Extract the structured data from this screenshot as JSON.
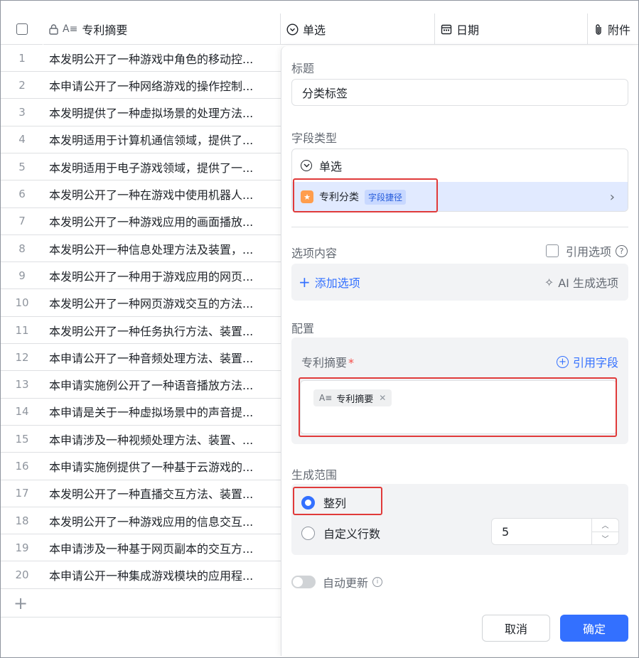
{
  "header": {
    "summary_col": "专利摘要",
    "single_col": "单选",
    "date_col": "日期",
    "attach_col": "附件"
  },
  "rows": [
    {
      "num": "1",
      "text": "本发明公开了一种游戏中角色的移动控..."
    },
    {
      "num": "2",
      "text": "本申请公开了一种网络游戏的操作控制..."
    },
    {
      "num": "3",
      "text": "本发明提供了一种虚拟场景的处理方法..."
    },
    {
      "num": "4",
      "text": "本发明适用于计算机通信领域，提供了..."
    },
    {
      "num": "5",
      "text": "本发明适用于电子游戏领域，提供了一..."
    },
    {
      "num": "6",
      "text": "本发明公开了一种在游戏中使用机器人..."
    },
    {
      "num": "7",
      "text": "本发明公开了一种游戏应用的画面播放..."
    },
    {
      "num": "8",
      "text": "本发明公开一种信息处理方法及装置，..."
    },
    {
      "num": "9",
      "text": "本发明公开了一种用于游戏应用的网页..."
    },
    {
      "num": "10",
      "text": "本发明公开了一种网页游戏交互的方法..."
    },
    {
      "num": "11",
      "text": "本发明公开了一种任务执行方法、装置..."
    },
    {
      "num": "12",
      "text": "本申请公开了一种音频处理方法、装置..."
    },
    {
      "num": "13",
      "text": "本申请实施例公开了一种语音播放方法..."
    },
    {
      "num": "14",
      "text": "本申请是关于一种虚拟场景中的声音提..."
    },
    {
      "num": "15",
      "text": "本申请涉及一种视频处理方法、装置、..."
    },
    {
      "num": "16",
      "text": "本申请实施例提供了一种基于云游戏的..."
    },
    {
      "num": "17",
      "text": "本发明公开了一种直播交互方法、装置..."
    },
    {
      "num": "18",
      "text": "本发明公开了一种游戏应用的信息交互..."
    },
    {
      "num": "19",
      "text": "本申请涉及一种基于网页副本的交互方..."
    },
    {
      "num": "20",
      "text": "本申请公开一种集成游戏模块的应用程..."
    }
  ],
  "panel": {
    "title_label": "标题",
    "title_value": "分类标签",
    "field_type_label": "字段类型",
    "field_type_current": "单选",
    "suggest_name": "专利分类",
    "suggest_tag": "字段捷径",
    "options_label": "选项内容",
    "ref_options": "引用选项",
    "add_option": "添加选项",
    "ai_generate": "AI 生成选项",
    "config_label": "配置",
    "config_field_label": "专利摘要",
    "required_mark": "*",
    "ref_field": "引用字段",
    "chip_label": "专利摘要",
    "range_label": "生成范围",
    "range_all": "整列",
    "range_custom": "自定义行数",
    "custom_rows_value": "5",
    "auto_update": "自动更新",
    "cancel": "取消",
    "confirm": "确定"
  },
  "colors": {
    "accent": "#3370ff",
    "highlight": "#e03a3a",
    "required": "#f54a45"
  },
  "icons": {
    "summary_col": "lock-text-icon",
    "single_col": "circle-chevron-icon",
    "date_col": "calendar-icon",
    "attach_col": "paperclip-icon"
  }
}
